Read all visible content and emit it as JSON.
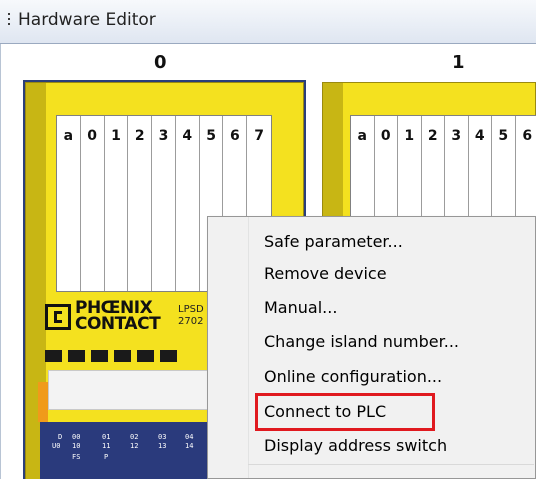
{
  "window": {
    "title": "Hardware Editor"
  },
  "slots": [
    {
      "number": "0",
      "column_labels": [
        "a",
        "0",
        "1",
        "2",
        "3",
        "4",
        "5",
        "6",
        "7"
      ],
      "logo_line1": "PHŒNIX",
      "logo_line2": "CONTACT",
      "product_line1": "LPSD",
      "product_line2": "2702",
      "terminal_labels": [
        "D",
        "U0",
        "00",
        "10",
        "01",
        "11",
        "FS",
        "02",
        "12",
        "P",
        "03",
        "13",
        "04",
        "14"
      ]
    },
    {
      "number": "1",
      "column_labels": [
        "a",
        "0",
        "1",
        "2",
        "3",
        "4",
        "5",
        "6"
      ]
    }
  ],
  "context_menu": {
    "items": [
      {
        "label": "Safe parameter..."
      },
      {
        "label": "Remove device"
      },
      {
        "label": "Manual..."
      },
      {
        "label": "Change island number..."
      },
      {
        "label": "Online configuration..."
      },
      {
        "label": "Connect to PLC",
        "highlighted": true
      },
      {
        "label": "Display address switch"
      }
    ],
    "highlight_color": "#e0191f"
  },
  "colors": {
    "device_yellow": "#f4e11f",
    "selection": "#2b3f7a",
    "terminal_blue": "#1f2f73",
    "orange_tab": "#f09a1a"
  }
}
